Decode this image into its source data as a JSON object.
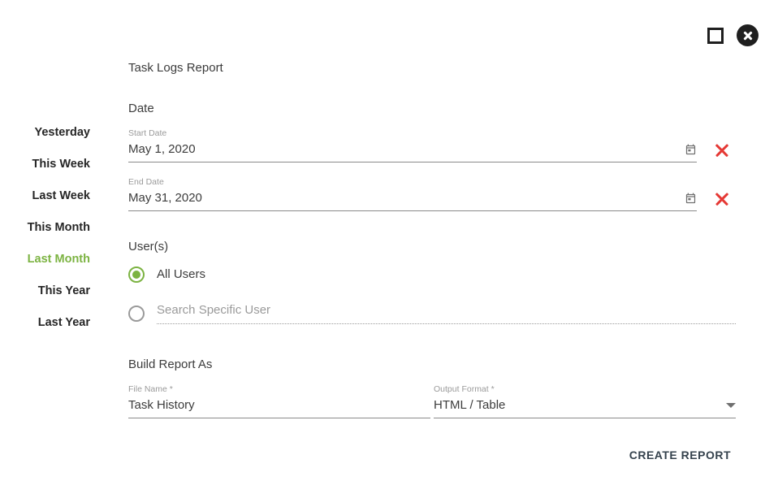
{
  "window": {
    "maximize_label": "Maximize",
    "close_label": "Close"
  },
  "presets": {
    "items": [
      {
        "label": "Yesterday",
        "active": false
      },
      {
        "label": "This Week",
        "active": false
      },
      {
        "label": "Last Week",
        "active": false
      },
      {
        "label": "This Month",
        "active": false
      },
      {
        "label": "Last Month",
        "active": true
      },
      {
        "label": "This Year",
        "active": false
      },
      {
        "label": "Last Year",
        "active": false
      }
    ],
    "active_color": "#7cb342",
    "inactive_color": "#262626"
  },
  "report": {
    "title": "Task Logs Report"
  },
  "date_section": {
    "heading": "Date",
    "start": {
      "label": "Start Date",
      "value": "May 1, 2020",
      "calendar_icon": "calendar-icon",
      "clear_icon": "clear-x-icon"
    },
    "end": {
      "label": "End Date",
      "value": "May 31, 2020",
      "calendar_icon": "calendar-icon",
      "clear_icon": "clear-x-icon"
    },
    "clear_color": "#e53935"
  },
  "users_section": {
    "heading": "User(s)",
    "options": [
      {
        "label": "All Users",
        "selected": true
      },
      {
        "label": "Search Specific User",
        "selected": false
      }
    ],
    "search_placeholder": "Search Specific User",
    "search_value": ""
  },
  "build_section": {
    "heading": "Build Report As",
    "file_name": {
      "label": "File Name *",
      "value": "Task History"
    },
    "output_format": {
      "label": "Output Format *",
      "value": "HTML / Table",
      "chevron_icon": "chevron-down-icon"
    }
  },
  "footer": {
    "create_label": "Create Report"
  }
}
